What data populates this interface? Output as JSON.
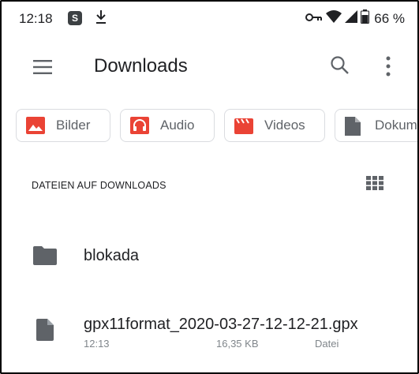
{
  "status_bar": {
    "time": "12:18",
    "notification_badge": "S",
    "battery_percent": "66 %",
    "icons": [
      "s-app-icon",
      "download-icon",
      "vpn-key-icon",
      "wifi-icon",
      "signal-icon",
      "battery-icon"
    ]
  },
  "toolbar": {
    "title": "Downloads",
    "icons": [
      "menu-icon",
      "search-icon",
      "more-vert-icon"
    ]
  },
  "filters": [
    {
      "label": "Bilder",
      "icon": "image-icon",
      "color": "#ea4335"
    },
    {
      "label": "Audio",
      "icon": "headphones-icon",
      "color": "#ea4335"
    },
    {
      "label": "Videos",
      "icon": "movie-icon",
      "color": "#ea4335"
    },
    {
      "label": "Dokum",
      "icon": "document-icon",
      "color": "#5f6368"
    }
  ],
  "section": {
    "title": "DATEIEN AUF DOWNLOADS",
    "view_icon": "grid-view-icon"
  },
  "items": [
    {
      "type": "folder",
      "name": "blokada",
      "icon": "folder-icon"
    },
    {
      "type": "file",
      "name": "gpx11format_2020-03-27-12-12-21.gpx",
      "time": "12:13",
      "size": "16,35 KB",
      "kind": "Datei",
      "icon": "file-icon"
    }
  ],
  "colors": {
    "accent_red": "#ea4335",
    "icon_grey": "#5f6368",
    "text_primary": "#202124",
    "text_secondary": "#80868b"
  }
}
